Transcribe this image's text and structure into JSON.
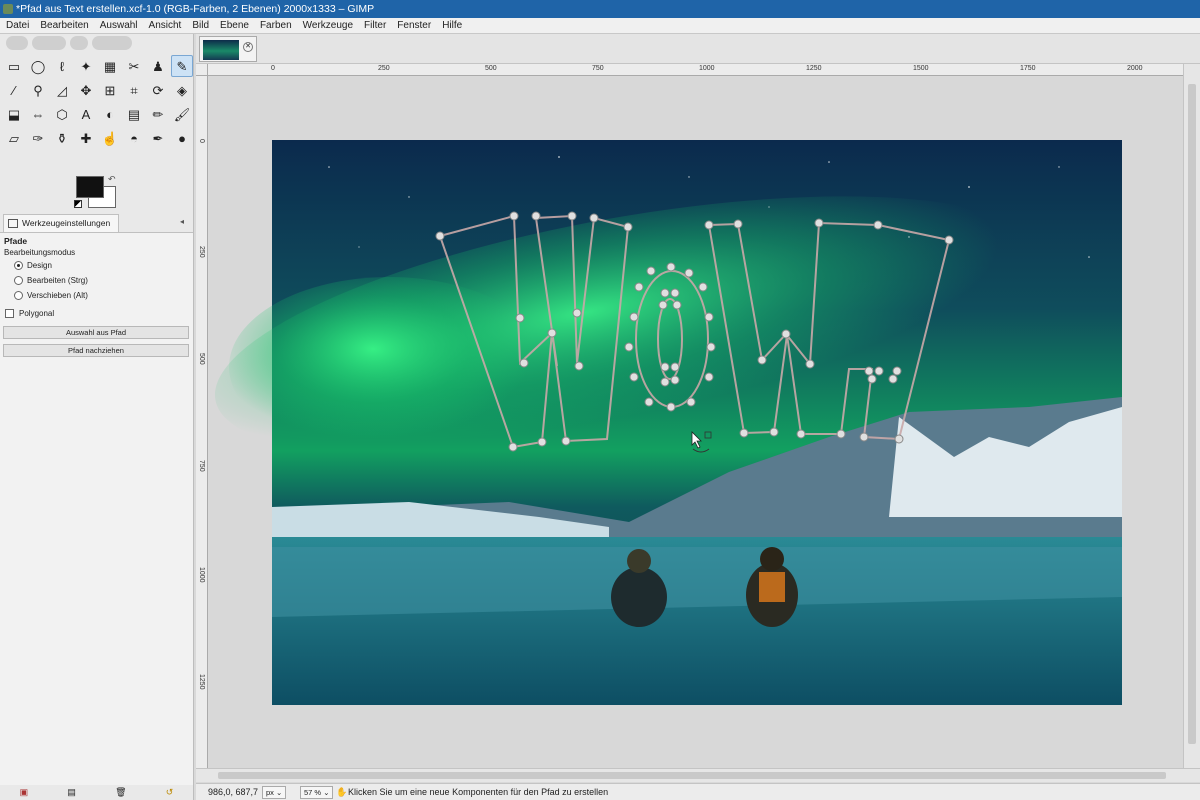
{
  "window": {
    "title": "*Pfad aus Text erstellen.xcf-1.0 (RGB-Farben, 2 Ebenen) 2000x1333 – GIMP"
  },
  "menu": [
    "Datei",
    "Bearbeiten",
    "Auswahl",
    "Ansicht",
    "Bild",
    "Ebene",
    "Farben",
    "Werkzeuge",
    "Filter",
    "Fenster",
    "Hilfe"
  ],
  "toolbox": {
    "tools": [
      {
        "name": "rect-select-icon",
        "glyph": "▭"
      },
      {
        "name": "ellipse-select-icon",
        "glyph": "◯"
      },
      {
        "name": "free-select-icon",
        "glyph": "ℓ"
      },
      {
        "name": "fuzzy-select-icon",
        "glyph": "✦"
      },
      {
        "name": "select-by-color-icon",
        "glyph": "▦"
      },
      {
        "name": "scissors-icon",
        "glyph": "✂"
      },
      {
        "name": "foreground-select-icon",
        "glyph": "♟"
      },
      {
        "name": "paths-icon",
        "glyph": "✎",
        "active": true
      },
      {
        "name": "color-picker-icon",
        "glyph": "⁄"
      },
      {
        "name": "zoom-icon",
        "glyph": "⚲"
      },
      {
        "name": "measure-icon",
        "glyph": "◿"
      },
      {
        "name": "move-icon",
        "glyph": "✥"
      },
      {
        "name": "align-icon",
        "glyph": "⊞"
      },
      {
        "name": "crop-icon",
        "glyph": "⌗"
      },
      {
        "name": "unified-transform-icon",
        "glyph": "⟳"
      },
      {
        "name": "warp-transform-icon",
        "glyph": "◈"
      },
      {
        "name": "perspective-icon",
        "glyph": "⬓"
      },
      {
        "name": "flip-icon",
        "glyph": "⇔"
      },
      {
        "name": "cage-transform-icon",
        "glyph": "⬡"
      },
      {
        "name": "text-icon",
        "glyph": "A"
      },
      {
        "name": "bucket-fill-icon",
        "glyph": "◐"
      },
      {
        "name": "gradient-icon",
        "glyph": "▤"
      },
      {
        "name": "pencil-icon",
        "glyph": "✏"
      },
      {
        "name": "paintbrush-icon",
        "glyph": "🖌"
      },
      {
        "name": "eraser-icon",
        "glyph": "▱"
      },
      {
        "name": "airbrush-icon",
        "glyph": "✑"
      },
      {
        "name": "clone-icon",
        "glyph": "⚱"
      },
      {
        "name": "heal-icon",
        "glyph": "✚"
      },
      {
        "name": "smudge-icon",
        "glyph": "☝"
      },
      {
        "name": "dodge-burn-icon",
        "glyph": "◓"
      },
      {
        "name": "ink-icon",
        "glyph": "✒"
      },
      {
        "name": "mypaint-brush-icon",
        "glyph": "●"
      }
    ],
    "options_tab": "Werkzeugeinstellungen",
    "options": {
      "title": "Pfade",
      "mode_label": "Bearbeitungsmodus",
      "modes": [
        {
          "label": "Design",
          "selected": true
        },
        {
          "label": "Bearbeiten (Strg)",
          "selected": false
        },
        {
          "label": "Verschieben (Alt)",
          "selected": false
        }
      ],
      "polygonal": {
        "label": "Polygonal",
        "checked": false
      },
      "btn_selection": "Auswahl aus Pfad",
      "btn_stroke": "Pfad nachziehen"
    }
  },
  "image_window": {
    "ruler_h": [
      "0",
      "250",
      "500",
      "750",
      "1000",
      "1250",
      "1500",
      "1750",
      "2000"
    ],
    "ruler_v": [
      "0",
      "250",
      "500",
      "750",
      "1000",
      "1250"
    ],
    "path_text": "WOW!"
  },
  "statusbar": {
    "coords": "986,0, 687,7",
    "unit": "px",
    "zoom": "57 %",
    "message": "Klicken Sie um eine neue Komponenten für den Pfad zu erstellen"
  }
}
